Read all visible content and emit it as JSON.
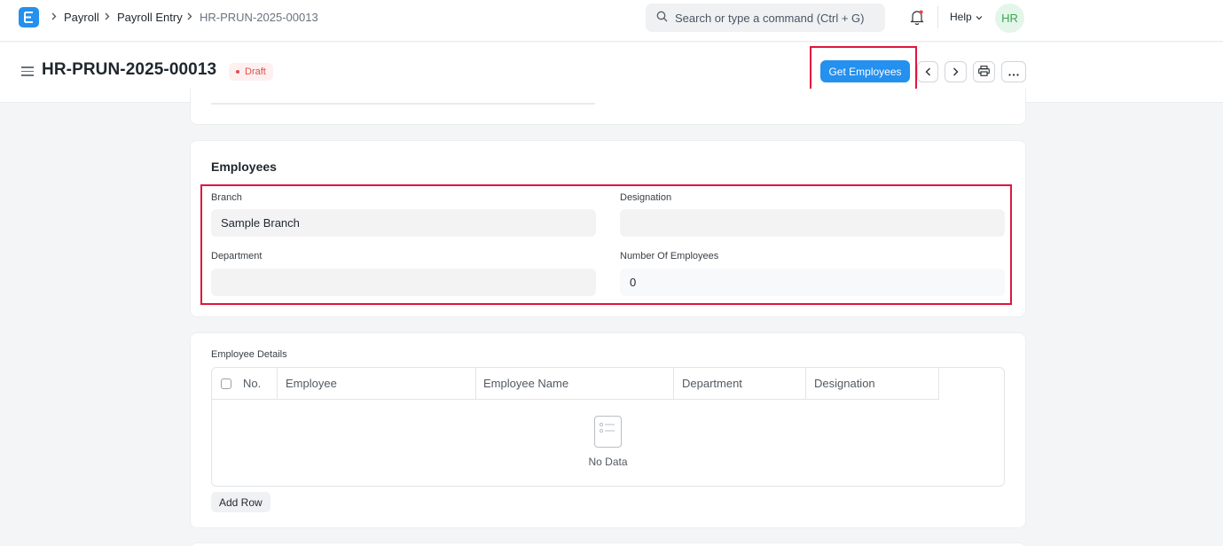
{
  "navbar": {
    "logo_letter": "E",
    "breadcrumbs": [
      "Payroll",
      "Payroll Entry",
      "HR-PRUN-2025-00013"
    ],
    "search_placeholder": "Search or type a command (Ctrl + G)",
    "help_label": "Help",
    "avatar_initials": "HR"
  },
  "header": {
    "title": "HR-PRUN-2025-00013",
    "status": "Draft",
    "primary_action": "Get Employees"
  },
  "employees_section": {
    "title": "Employees",
    "fields": {
      "branch": {
        "label": "Branch",
        "value": "Sample Branch"
      },
      "designation": {
        "label": "Designation",
        "value": ""
      },
      "department": {
        "label": "Department",
        "value": ""
      },
      "number_of_employees": {
        "label": "Number Of Employees",
        "value": "0"
      }
    }
  },
  "employee_details": {
    "label": "Employee Details",
    "columns": [
      "No.",
      "Employee",
      "Employee Name",
      "Department",
      "Designation"
    ],
    "empty_text": "No Data",
    "add_row_label": "Add Row"
  },
  "colors": {
    "primary": "#2490ef",
    "highlight": "#e0153f",
    "draft": "#e24c4c"
  }
}
